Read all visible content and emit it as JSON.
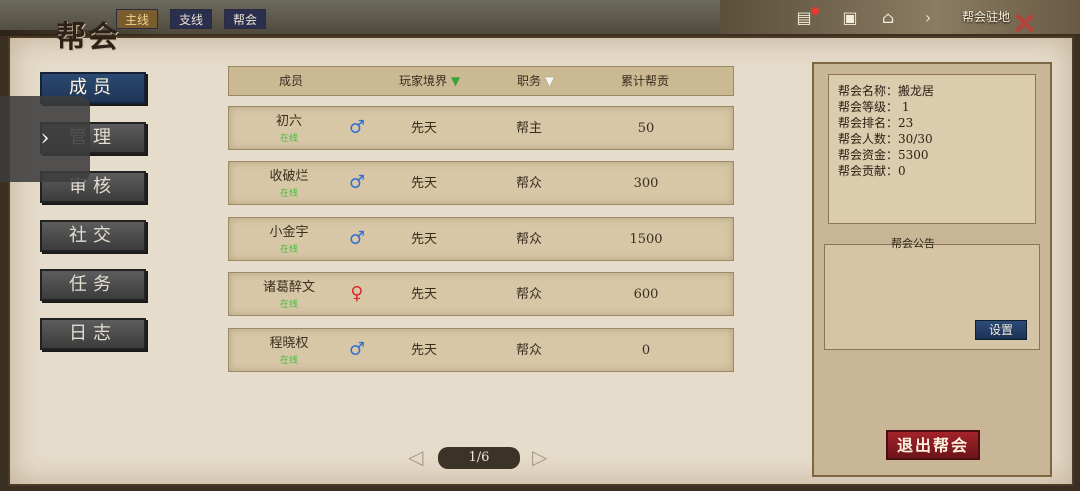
{
  "top": {
    "tabs": [
      "主线",
      "支线",
      "帮会"
    ],
    "corner_label": "帮会驻地",
    "icons": [
      "scroll-icon",
      "bag-icon",
      "pagoda-icon",
      "chevron-right-icon"
    ],
    "close": "✕"
  },
  "title": "帮会",
  "nav": [
    "成员",
    "管理",
    "审核",
    "社交",
    "任务",
    "日志"
  ],
  "table": {
    "headers": {
      "member": "成员",
      "realm": "玩家境界",
      "role": "职务",
      "contribution": "累计帮贡"
    },
    "rows": [
      {
        "name": "初六",
        "status": "在线",
        "gender": "♂",
        "realm": "先天",
        "role": "帮主",
        "contribution": "50"
      },
      {
        "name": "收破烂",
        "status": "在线",
        "gender": "♂",
        "realm": "先天",
        "role": "帮众",
        "contribution": "300"
      },
      {
        "name": "小金宇",
        "status": "在线",
        "gender": "♂",
        "realm": "先天",
        "role": "帮众",
        "contribution": "1500"
      },
      {
        "name": "诸葛醉文",
        "status": "在线",
        "gender": "♀",
        "realm": "先天",
        "role": "帮众",
        "contribution": "600"
      },
      {
        "name": "程晓权",
        "status": "在线",
        "gender": "♂",
        "realm": "先天",
        "role": "帮众",
        "contribution": "0"
      }
    ]
  },
  "pagination": {
    "label": "1/6"
  },
  "info": {
    "lines": [
      "帮会名称：搬龙居",
      "帮会等级： 1",
      "帮会排名：23",
      "帮会人数：30/30",
      "帮会资金：5300",
      "帮会贡献：0"
    ],
    "notice_title": "帮会公告",
    "set_label": "设置",
    "leave_label": "退出帮会"
  },
  "colors": {
    "accent_blue": "#2c4a72",
    "leave_red": "#a3232b",
    "online_green": "#3fbf3f",
    "male_blue": "#2e6dd6",
    "female_red": "#d92b2b"
  }
}
